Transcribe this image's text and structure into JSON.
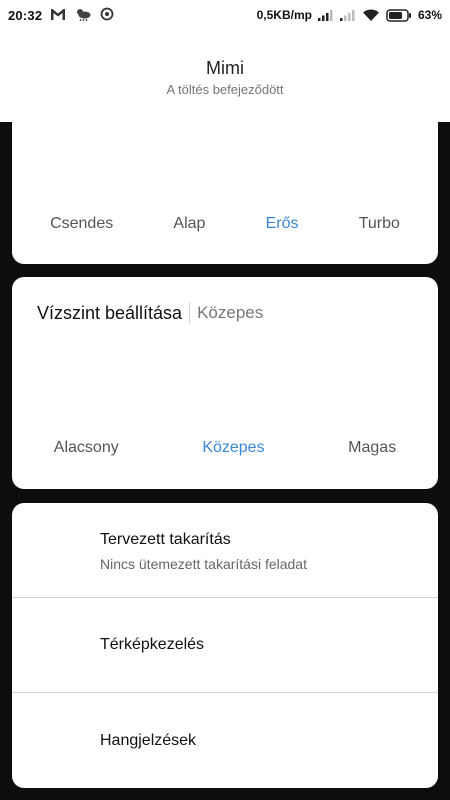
{
  "status_bar": {
    "time": "20:32",
    "network_speed": "0,5KB/mp",
    "battery": "63%",
    "left_icons": [
      "gmail-icon",
      "weather-icon",
      "sync-icon"
    ]
  },
  "header": {
    "title": "Mimi",
    "subtitle": "A töltés befejeződött"
  },
  "suction_power": {
    "options": [
      "Csendes",
      "Alap",
      "Erős",
      "Turbo"
    ],
    "selected": "Erős"
  },
  "water_level": {
    "label": "Vízszint beállítása",
    "value": "Közepes",
    "options": [
      "Alacsony",
      "Közepes",
      "Magas"
    ],
    "selected": "Közepes"
  },
  "menu": {
    "scheduled_title": "Tervezett takarítás",
    "scheduled_subtitle": "Nincs ütemezett takarítási feladat",
    "map_title": "Térképkezelés",
    "sounds_title": "Hangjelzések"
  },
  "colors": {
    "accent": "#3b87d8",
    "background": "#0d0d0d",
    "card": "#ffffff"
  }
}
